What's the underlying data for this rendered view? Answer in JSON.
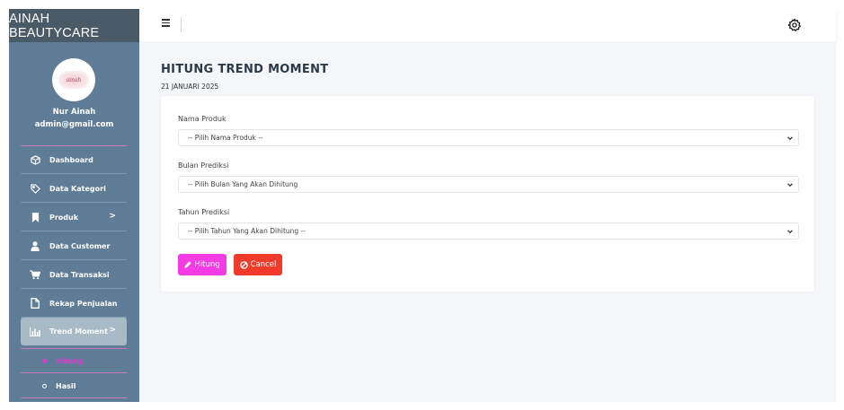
{
  "app": {
    "brand": "AINAH BEAUTYCARE"
  },
  "user": {
    "name": "Nur Ainah",
    "email": "admin@gmail.com",
    "avatar_text": "ainah"
  },
  "sidebar": {
    "items": [
      {
        "label": "Dashboard",
        "icon": "cube-icon"
      },
      {
        "label": "Data Kategori",
        "icon": "tag-icon"
      },
      {
        "label": "Produk",
        "icon": "bookmark-icon",
        "chevron": ">"
      },
      {
        "label": "Data Customer",
        "icon": "user-icon"
      },
      {
        "label": "Data Transaksi",
        "icon": "cart-icon"
      },
      {
        "label": "Rekap Penjualan",
        "icon": "file-icon"
      },
      {
        "label": "Trend Moment",
        "icon": "chart-bar-icon",
        "chevron": ">",
        "active": true
      }
    ],
    "subitems": [
      {
        "label": "Hitung",
        "active": true
      },
      {
        "label": "Hasil",
        "active": false
      }
    ]
  },
  "page": {
    "title": "HITUNG TREND MOMENT",
    "date": "21 JANUARI 2025"
  },
  "form": {
    "produk_label": "Nama Produk",
    "produk_value": "-- Pilih Nama Produk --",
    "bulan_label": "Bulan Prediksi",
    "bulan_value": "-- Pilih Bulan Yang Akan Dihitung",
    "tahun_label": "Tahun Prediksi",
    "tahun_value": "-- Pilih Tahun Yang Akan Dihitung --",
    "hitung_label": "Hitung",
    "cancel_label": "Cancel"
  },
  "colors": {
    "sidebar_bg": "#5f7d96",
    "brand_bg": "#4a5a67",
    "active_item_bg": "#a9bac7",
    "submenu_active": "#e23ad6",
    "hitung_button": "#f53be4",
    "cancel_button": "#f03a2a",
    "content_bg": "#f4f6f9"
  }
}
